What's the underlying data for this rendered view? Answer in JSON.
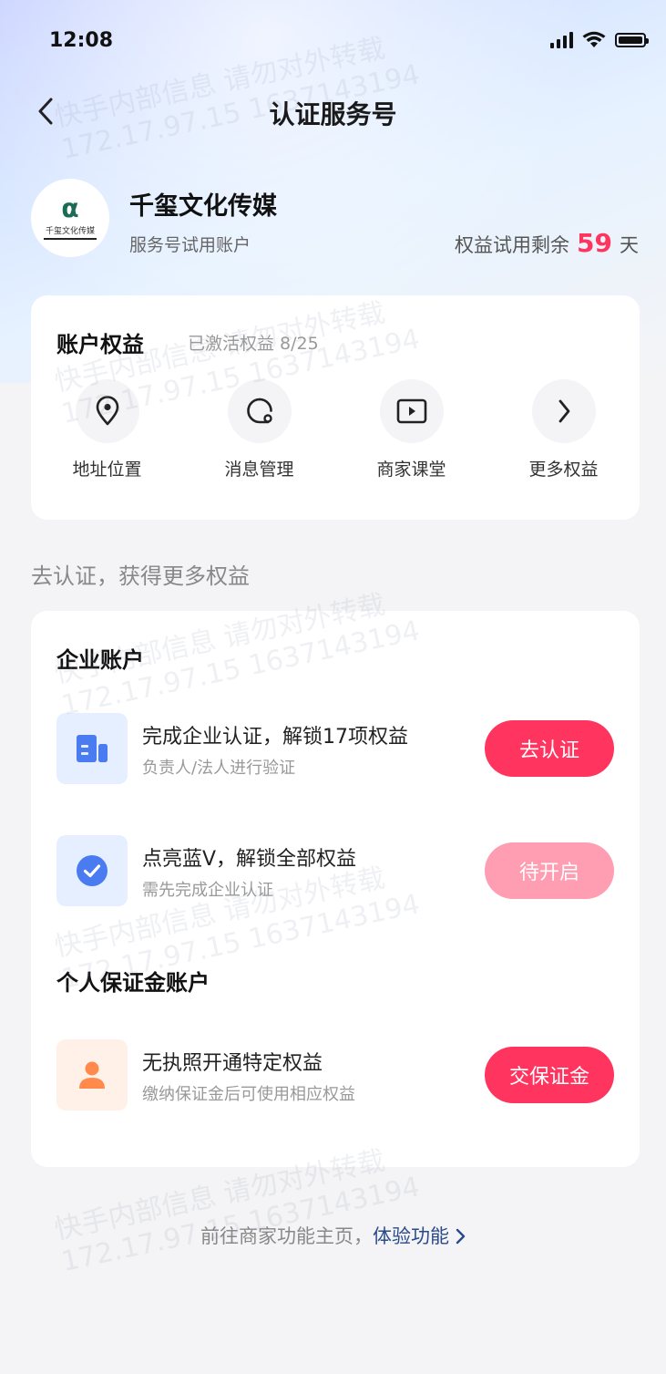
{
  "status_bar": {
    "time": "12:08"
  },
  "nav": {
    "title": "认证服务号"
  },
  "profile": {
    "avatar_mark": "α",
    "avatar_text": "千玺文化传媒",
    "name": "千玺文化传媒",
    "subtitle": "服务号试用账户",
    "trial_prefix": "权益试用剩余",
    "trial_days": "59",
    "trial_unit": "天"
  },
  "rights": {
    "title": "账户权益",
    "activated": "已激活权益 8/25",
    "items": [
      {
        "label": "地址位置",
        "icon": "location-pin-icon"
      },
      {
        "label": "消息管理",
        "icon": "chat-bubble-icon"
      },
      {
        "label": "商家课堂",
        "icon": "play-icon"
      },
      {
        "label": "更多权益",
        "icon": "chevron-right-icon"
      }
    ]
  },
  "section_hint": "去认证，获得更多权益",
  "enterprise": {
    "title": "企业账户",
    "rows": [
      {
        "title": "完成企业认证，解锁17项权益",
        "subtitle": "负责人/法人进行验证",
        "button": "去认证",
        "icon": "building-icon"
      },
      {
        "title": "点亮蓝V，解锁全部权益",
        "subtitle": "需先完成企业认证",
        "button": "待开启",
        "icon": "check-badge-icon"
      }
    ]
  },
  "personal": {
    "title": "个人保证金账户",
    "rows": [
      {
        "title": "无执照开通特定权益",
        "subtitle": "缴纳保证金后可使用相应权益",
        "button": "交保证金",
        "icon": "person-icon"
      }
    ]
  },
  "footer": {
    "text": "前往商家功能主页，",
    "link": "体验功能"
  },
  "watermark": {
    "line1": "快手内部信息 请勿对外转载",
    "line2": "172.17.97.15 1637143194"
  },
  "colors": {
    "accent": "#ff3560",
    "accent_disabled": "#ff9db2",
    "link": "#2a4a8a",
    "icon_blue": "#4a7bf0",
    "icon_orange": "#ff8a4c"
  }
}
